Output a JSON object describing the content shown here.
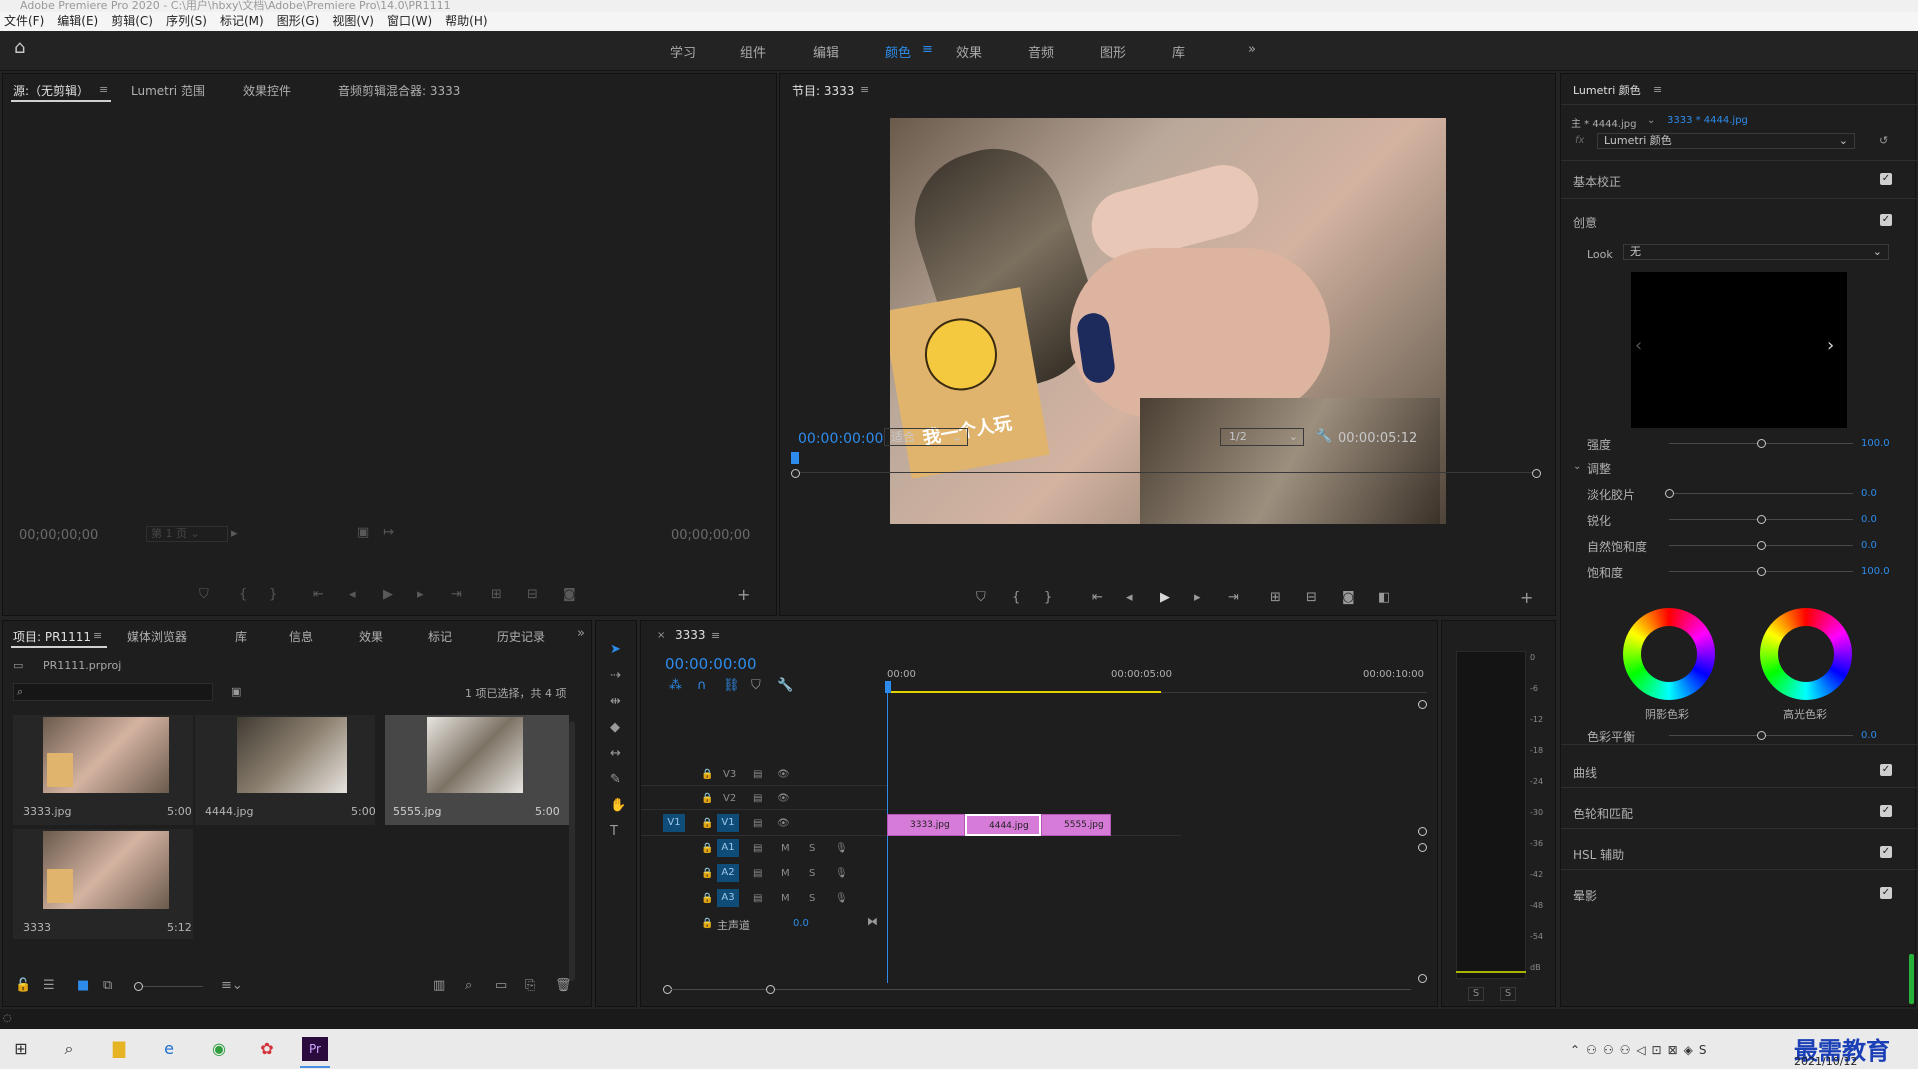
{
  "window": {
    "title": "Adobe Premiere Pro 2020 - C:\\用户\\hbxy\\文档\\Adobe\\Premiere Pro\\14.0\\PR1111"
  },
  "menu": [
    "文件(F)",
    "编辑(E)",
    "剪辑(C)",
    "序列(S)",
    "标记(M)",
    "图形(G)",
    "视图(V)",
    "窗口(W)",
    "帮助(H)"
  ],
  "workspaces": [
    {
      "label": "学习",
      "active": false
    },
    {
      "label": "组件",
      "active": false
    },
    {
      "label": "编辑",
      "active": false
    },
    {
      "label": "颜色",
      "active": true
    },
    {
      "label": "效果",
      "active": false
    },
    {
      "label": "音频",
      "active": false
    },
    {
      "label": "图形",
      "active": false
    },
    {
      "label": "库",
      "active": false
    }
  ],
  "source_panel": {
    "tabs": [
      "源:（无剪辑）",
      "Lumetri 范围",
      "效果控件",
      "音频剪辑混合器: 3333"
    ],
    "timecode_left": "00;00;00;00",
    "page": "第 1 页",
    "timecode_right": "00;00;00;00"
  },
  "program_panel": {
    "tab": "节目: 3333",
    "timecode": "00:00:00:00",
    "fit": "适合",
    "resolution": "1/2",
    "duration": "00:00:05:12",
    "sticker_text": "我一个人玩"
  },
  "project_panel": {
    "tabs": [
      "项目: PR1111",
      "媒体浏览器",
      "库",
      "信息",
      "效果",
      "标记",
      "历史记录"
    ],
    "project_file": "PR1111.prproj",
    "selection_status": "1 项已选择，共 4 项",
    "items": [
      {
        "name": "3333.jpg",
        "duration": "5:00"
      },
      {
        "name": "4444.jpg",
        "duration": "5:00"
      },
      {
        "name": "5555.jpg",
        "duration": "5:00"
      },
      {
        "name": "3333",
        "duration": "5:12"
      }
    ]
  },
  "timeline": {
    "tab": "3333",
    "timecode": "00:00:00:00",
    "ruler": [
      "00:00",
      "00:00:05:00",
      "00:00:10:00"
    ],
    "video_tracks": [
      "V3",
      "V2",
      "V1"
    ],
    "audio_tracks": [
      "A1",
      "A2",
      "A3"
    ],
    "source_patch": "V1",
    "mute": "M",
    "solo": "S",
    "master": {
      "label": "主声道",
      "value": "0.0"
    },
    "clips": [
      "3333.jpg",
      "4444.jpg",
      "5555.jpg"
    ]
  },
  "meter": {
    "scale": [
      "0",
      "-6",
      "-12",
      "-18",
      "-24",
      "-30",
      "-36",
      "-42",
      "-48",
      "-54",
      "dB"
    ],
    "solo_buttons": [
      "S",
      "S"
    ]
  },
  "lumetri": {
    "panel_title": "Lumetri 颜色",
    "master_clip": "主 * 4444.jpg",
    "sequence_clip": "3333 * 4444.jpg",
    "fx_label": "fx",
    "effect": "Lumetri 颜色",
    "sections": {
      "basic": "基本校正",
      "creative": "创意",
      "curves": "曲线",
      "wheels": "色轮和匹配",
      "hsl": "HSL 辅助",
      "vignette": "晕影"
    },
    "look_label": "Look",
    "look_value": "无",
    "intensity": {
      "label": "强度",
      "value": "100.0",
      "fraction": 0.5
    },
    "adjust_label": "调整",
    "sliders": [
      {
        "label": "淡化胶片",
        "value": "0.0",
        "fraction": 0.0
      },
      {
        "label": "锐化",
        "value": "0.0",
        "fraction": 0.5
      },
      {
        "label": "自然饱和度",
        "value": "0.0",
        "fraction": 0.5
      },
      {
        "label": "饱和度",
        "value": "100.0",
        "fraction": 0.5
      }
    ],
    "shadow_label": "阴影色彩",
    "highlight_label": "高光色彩",
    "balance": {
      "label": "色彩平衡",
      "value": "0.0",
      "fraction": 0.5
    }
  },
  "taskbar": {
    "date": "2021/10/12",
    "watermark": "最需教育"
  },
  "colors": {
    "accent": "#2d8ceb",
    "clip": "#d77bd8",
    "track_button": "#0f4c77"
  }
}
